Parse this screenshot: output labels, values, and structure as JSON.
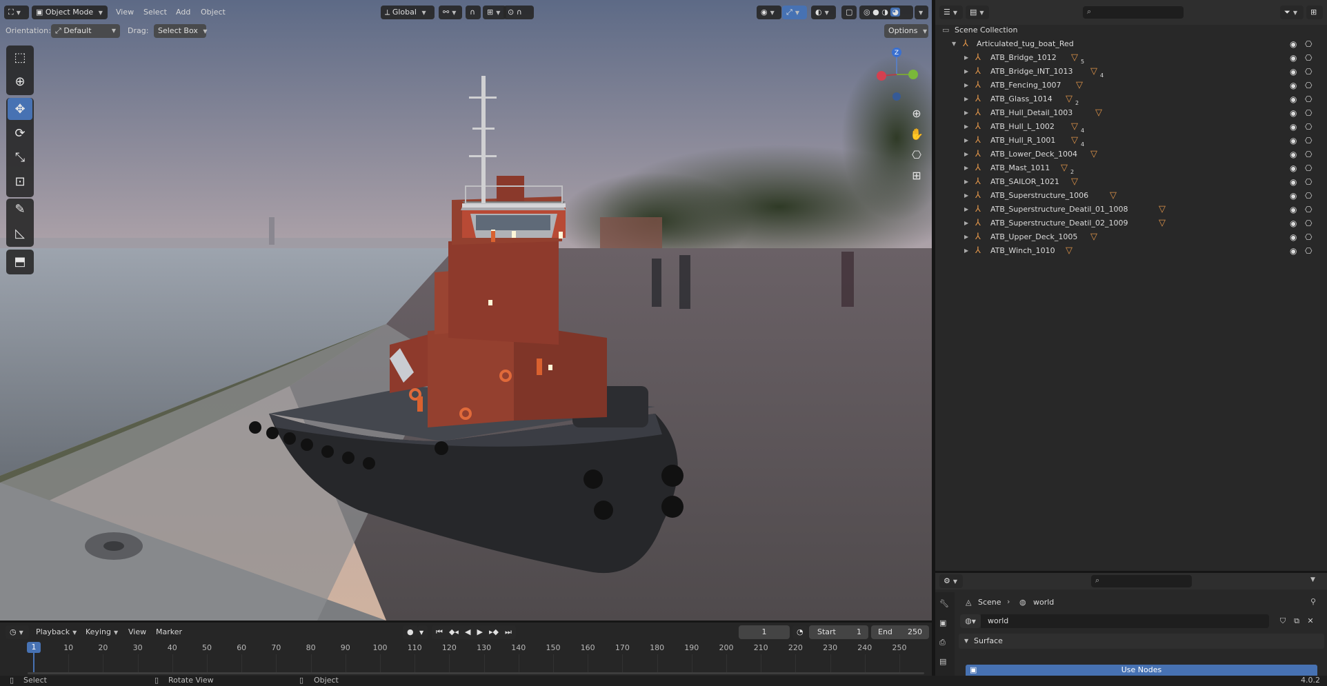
{
  "viewport_header": {
    "mode": "Object Mode",
    "menus": [
      "View",
      "Select",
      "Add",
      "Object"
    ],
    "transform_orientation": "Global",
    "options_label": "Options"
  },
  "tool_settings": {
    "orientation_label": "Orientation:",
    "orientation_value": "Default",
    "drag_label": "Drag:",
    "drag_value": "Select Box"
  },
  "nav_gizmo": {
    "z": "Z"
  },
  "toolbar": [
    {
      "name": "select-box-tool",
      "icon": "cursor-icon",
      "active": false
    },
    {
      "name": "cursor-tool",
      "icon": "crosshair-icon",
      "active": false
    },
    {
      "name": "move-tool",
      "icon": "move-icon",
      "active": true
    },
    {
      "name": "rotate-tool",
      "icon": "rotate-icon",
      "active": false
    },
    {
      "name": "scale-tool",
      "icon": "scale-icon",
      "active": false
    },
    {
      "name": "transform-tool",
      "icon": "transform-icon",
      "active": false
    },
    {
      "name": "annotate-tool",
      "icon": "pen-icon",
      "active": false
    },
    {
      "name": "measure-tool",
      "icon": "ruler-icon",
      "active": false
    },
    {
      "name": "add-cube-tool",
      "icon": "cube-icon",
      "active": false
    }
  ],
  "outliner": {
    "root": "Scene Collection",
    "collection": "Articulated_tug_boat_Red",
    "items": [
      {
        "label": "ATB_Bridge_1012",
        "count": "5"
      },
      {
        "label": "ATB_Bridge_INT_1013",
        "count": "4"
      },
      {
        "label": "ATB_Fencing_1007",
        "count": ""
      },
      {
        "label": "ATB_Glass_1014",
        "count": "2"
      },
      {
        "label": "ATB_Hull_Detail_1003",
        "count": ""
      },
      {
        "label": "ATB_Hull_L_1002",
        "count": "4"
      },
      {
        "label": "ATB_Hull_R_1001",
        "count": "4"
      },
      {
        "label": "ATB_Lower_Deck_1004",
        "count": ""
      },
      {
        "label": "ATB_Mast_1011",
        "count": "2"
      },
      {
        "label": "ATB_SAILOR_1021",
        "count": ""
      },
      {
        "label": "ATB_Superstructure_1006",
        "count": ""
      },
      {
        "label": "ATB_Superstructure_Deatil_01_1008",
        "count": ""
      },
      {
        "label": "ATB_Superstructure_Deatil_02_1009",
        "count": ""
      },
      {
        "label": "ATB_Upper_Deck_1005",
        "count": ""
      },
      {
        "label": "ATB_Winch_1010",
        "count": ""
      }
    ]
  },
  "properties": {
    "breadcrumb_scene": "Scene",
    "breadcrumb_world": "world",
    "world_name": "world",
    "panel": "Surface",
    "use_nodes": "Use Nodes"
  },
  "timeline": {
    "menus": [
      "Playback",
      "Keying",
      "View",
      "Marker"
    ],
    "current_frame": "1",
    "start_label": "Start",
    "start": "1",
    "end_label": "End",
    "end": "250",
    "ruler": [
      "1",
      "10",
      "20",
      "30",
      "40",
      "50",
      "60",
      "70",
      "80",
      "90",
      "100",
      "110",
      "120",
      "130",
      "140",
      "150",
      "160",
      "170",
      "180",
      "190",
      "200",
      "210",
      "220",
      "230",
      "240",
      "250"
    ]
  },
  "statusbar": {
    "items": [
      "Select",
      "Rotate View",
      "Object"
    ],
    "version": "4.0.2"
  },
  "colors": {
    "accent": "#4772b3",
    "mesh": "#e0954a",
    "hull_red": "#8e3a2c"
  }
}
